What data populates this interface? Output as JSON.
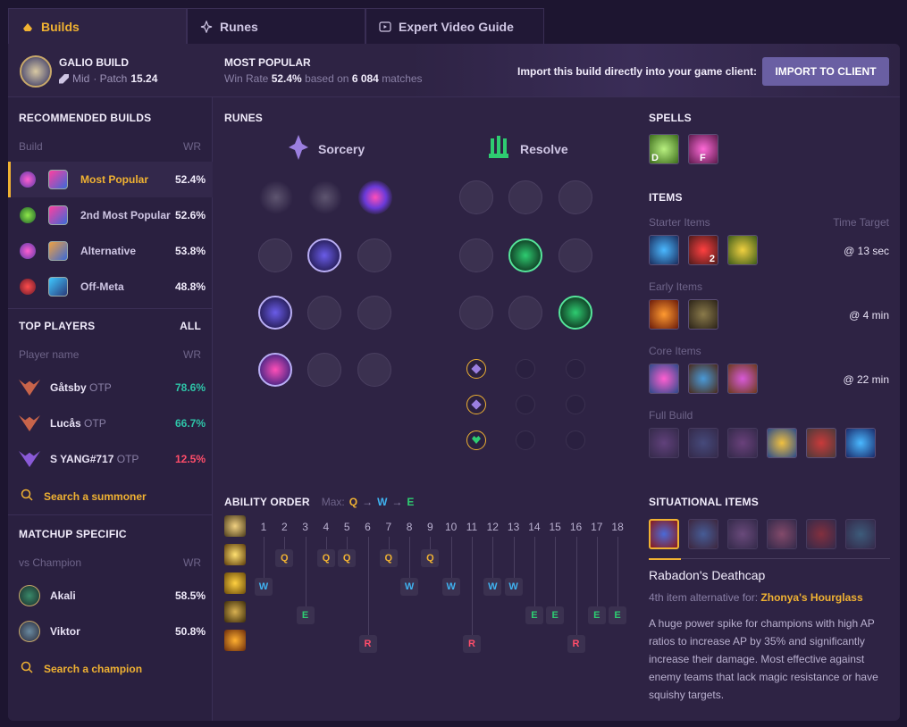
{
  "tabs": [
    {
      "label": "Builds",
      "icon": "helmet-icon",
      "active": true
    },
    {
      "label": "Runes",
      "icon": "rune-icon",
      "active": false
    },
    {
      "label": "Expert Video Guide",
      "icon": "video-icon",
      "active": false
    }
  ],
  "header": {
    "champion_build": "GALIO BUILD",
    "role": "Mid",
    "patch_prefix": "· Patch",
    "patch": "15.24",
    "popularity_title": "MOST POPULAR",
    "win_rate_label": "Win Rate",
    "win_rate": "52.4%",
    "based_on": "based on",
    "matches": "6 084",
    "matches_label": "matches",
    "import_text": "Import this build directly into your game client:",
    "import_button": "IMPORT TO CLIENT"
  },
  "recommended": {
    "title": "RECOMMENDED BUILDS",
    "col_build": "Build",
    "col_wr": "WR",
    "builds": [
      {
        "name": "Most Popular",
        "wr": "52.4%",
        "active": true
      },
      {
        "name": "2nd Most Popular",
        "wr": "52.6%",
        "active": false
      },
      {
        "name": "Alternative",
        "wr": "53.8%",
        "active": false
      },
      {
        "name": "Off-Meta",
        "wr": "48.8%",
        "active": false
      }
    ]
  },
  "top_players": {
    "title": "TOP PLAYERS",
    "all": "ALL",
    "col_name": "Player name",
    "col_wr": "WR",
    "players": [
      {
        "name": "Gåtsby",
        "tag": "OTP",
        "wr": "78.6%",
        "color": "#2ec5a8"
      },
      {
        "name": "Lucås",
        "tag": "OTP",
        "wr": "66.7%",
        "color": "#2ec5a8"
      },
      {
        "name": "S YANG#717",
        "tag": "OTP",
        "wr": "12.5%",
        "color": "#ff4d6a"
      }
    ],
    "search": "Search a summoner"
  },
  "matchup": {
    "title": "MATCHUP SPECIFIC",
    "col_vs": "vs Champion",
    "col_wr": "WR",
    "champions": [
      {
        "name": "Akali",
        "wr": "58.5%"
      },
      {
        "name": "Viktor",
        "wr": "50.8%"
      }
    ],
    "search": "Search a champion"
  },
  "runes": {
    "title": "RUNES",
    "primary": "Sorcery",
    "secondary": "Resolve"
  },
  "spells": {
    "title": "SPELLS",
    "keys": [
      "D",
      "F"
    ]
  },
  "items": {
    "title": "ITEMS",
    "starter_label": "Starter Items",
    "time_target_label": "Time Target",
    "starter_time": "@ 13 sec",
    "starter_count": "2",
    "early_label": "Early Items",
    "early_time": "@ 4 min",
    "core_label": "Core Items",
    "core_time": "@ 22 min",
    "full_label": "Full Build"
  },
  "ability_order": {
    "title": "ABILITY ORDER",
    "max_label": "Max:",
    "max_seq": [
      "Q",
      "W",
      "E"
    ],
    "levels": [
      "1",
      "2",
      "3",
      "4",
      "5",
      "6",
      "7",
      "8",
      "9",
      "10",
      "11",
      "12",
      "13",
      "14",
      "15",
      "16",
      "17",
      "18"
    ],
    "rows": [
      {
        "key": "Q",
        "levels": [
          2,
          4,
          5,
          7,
          9
        ]
      },
      {
        "key": "W",
        "levels": [
          1,
          8,
          10,
          12,
          13
        ]
      },
      {
        "key": "E",
        "levels": [
          3,
          14,
          15,
          17,
          18
        ]
      },
      {
        "key": "R",
        "levels": [
          6,
          11,
          16
        ]
      }
    ]
  },
  "situational": {
    "title": "SITUATIONAL ITEMS",
    "item_name": "Rabadon's Deathcap",
    "alt_label": "4th item alternative for:",
    "alt_item": "Zhonya's Hourglass",
    "description": "A huge power spike for champions with high AP ratios to increase AP by 35% and significantly increase their damage. Most effective against enemy teams that lack magic resistance or have squishy targets."
  },
  "colors": {
    "accent": "#f0b232",
    "button": "#6a5fa3",
    "win_green": "#2ec5a8",
    "loss_red": "#ff4d6a"
  }
}
